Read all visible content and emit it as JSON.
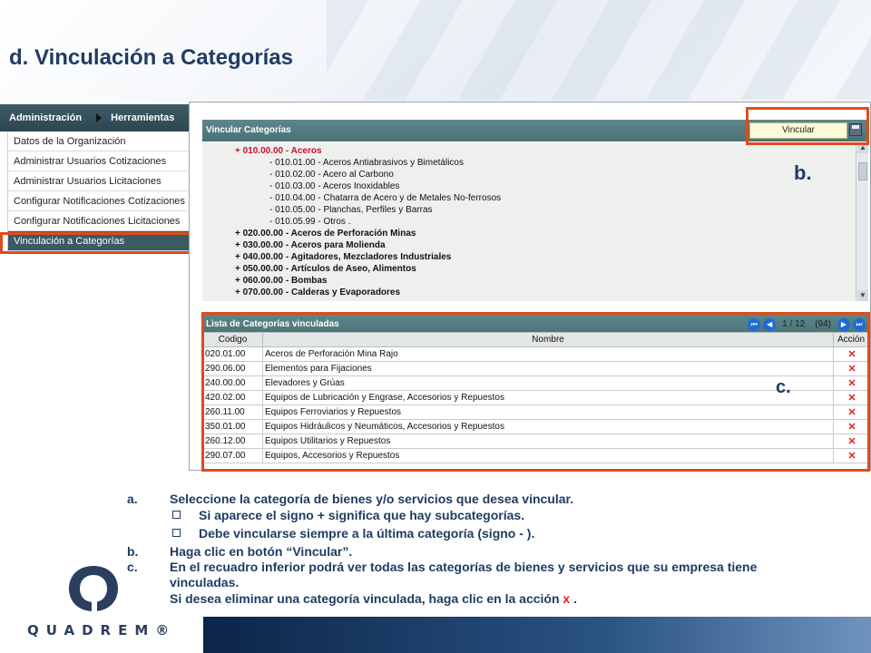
{
  "slide": {
    "title": "d. Vinculación a Categorías"
  },
  "left_menu": {
    "tabs": [
      "Administración",
      "Herramientas"
    ],
    "items": [
      "Datos de la Organización",
      "Administrar Usuarios Cotizaciones",
      "Administrar Usuarios Licitaciones",
      "Configurar Notificaciones Cotizaciones",
      "Configurar Notificaciones Licitaciones",
      "Vinculación a Categorías"
    ],
    "active_index": 5
  },
  "vincular_panel": {
    "title": "Vincular Categorías",
    "button": "Vincular",
    "tree": [
      {
        "text": "+ 010.00.00 - Aceros",
        "level": 0,
        "expanded": true
      },
      {
        "text": "- 010.01.00 - Aceros Antiabrasivos y Bimetálicos",
        "level": 1
      },
      {
        "text": "- 010.02.00 - Acero al Carbono",
        "level": 1
      },
      {
        "text": "- 010.03.00 - Aceros Inoxidables",
        "level": 1
      },
      {
        "text": "- 010.04.00 - Chatarra de Acero y de Metales No-ferrosos",
        "level": 1
      },
      {
        "text": "- 010.05.00 - Planchas, Perfiles y Barras",
        "level": 1
      },
      {
        "text": "- 010.05.99 - Otros                              .",
        "level": 1
      },
      {
        "text": "+ 020.00.00 - Aceros de Perforación Minas",
        "level": 0
      },
      {
        "text": "+ 030.00.00 - Aceros para Molienda",
        "level": 0
      },
      {
        "text": "+ 040.00.00 - Agitadores, Mezcladores Industriales",
        "level": 0
      },
      {
        "text": "+ 050.00.00 - Artículos de Aseo, Alimentos",
        "level": 0
      },
      {
        "text": "+ 060.00.00 - Bombas",
        "level": 0
      },
      {
        "text": "+ 070.00.00 - Calderas y Evaporadores",
        "level": 0
      }
    ]
  },
  "list_panel": {
    "title": "Lista de Categorías vinculadas",
    "pager": {
      "page": "1 / 12",
      "total": "(94)"
    },
    "columns": [
      "Codigo",
      "Nombre",
      "Acción"
    ],
    "rows": [
      {
        "code": "020.01.00",
        "name": "Aceros de Perforación Mina Rajo",
        "action": "✕"
      },
      {
        "code": "290.06.00",
        "name": "Elementos para Fijaciones",
        "action": "✕"
      },
      {
        "code": "240.00.00",
        "name": "Elevadores y Grúas",
        "action": "✕"
      },
      {
        "code": "420.02.00",
        "name": "Equipos de Lubricación y Engrase, Accesorios y Repuestos",
        "action": "✕"
      },
      {
        "code": "260.11.00",
        "name": "Equipos Ferroviarios y Repuestos",
        "action": "✕"
      },
      {
        "code": "350.01.00",
        "name": "Equipos Hidráulicos y Neumáticos, Accesorios y Repuestos",
        "action": "✕"
      },
      {
        "code": "260.12.00",
        "name": "Equipos Utilitarios y Repuestos",
        "action": "✕"
      },
      {
        "code": "290.07.00",
        "name": "Equipos, Accesorios y Repuestos",
        "action": "✕"
      }
    ]
  },
  "callouts": {
    "b": "b.",
    "c": "c."
  },
  "instructions": {
    "a_marker": "a.",
    "a_text": "Seleccione la categoría de bienes y/o servicios que desea vincular.",
    "bullet1": "Si aparece el signo + significa que hay subcategorías.",
    "bullet2": "Debe vincularse siempre a la última categoría (signo - ).",
    "b_marker": "b.",
    "b_text": "Haga clic en botón “Vincular”.",
    "c_marker": "c.",
    "c_text_line1": "En el recuadro inferior podrá ver todas  las categorías de bienes y servicios que su empresa tiene",
    "c_text_line2": "vinculadas.",
    "c_text_line3": "Si desea eliminar una categoría vinculada, haga clic en la acción",
    "c_text_x": "x",
    "c_text_end": "."
  },
  "logo": {
    "text": "QUADREM®"
  },
  "colors": {
    "accent": "#1f3c64",
    "highlight": "#e04b1c",
    "header": "#4a7276",
    "delete": "#e0201c"
  }
}
